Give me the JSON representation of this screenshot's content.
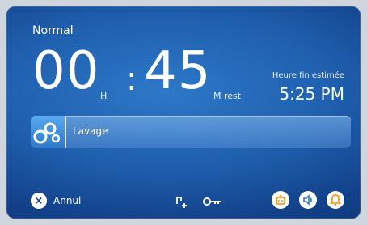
{
  "status": {
    "mode": "Normal"
  },
  "timer": {
    "hours": "00",
    "hours_unit": "H",
    "colon": ":",
    "minutes": "45",
    "minutes_unit": "M rest"
  },
  "eta": {
    "label": "Heure fin estimée",
    "time": "5:25 PM"
  },
  "cycle": {
    "label": "Lavage"
  },
  "bottom": {
    "cancel_label": "Annul",
    "icons": [
      "child-lock-icon",
      "key-icon",
      "robot-icon",
      "speaker-icon",
      "alarm-icon"
    ]
  },
  "colors": {
    "accent_blue": "#2e78c8",
    "icon_orange": "#ff8a00"
  }
}
